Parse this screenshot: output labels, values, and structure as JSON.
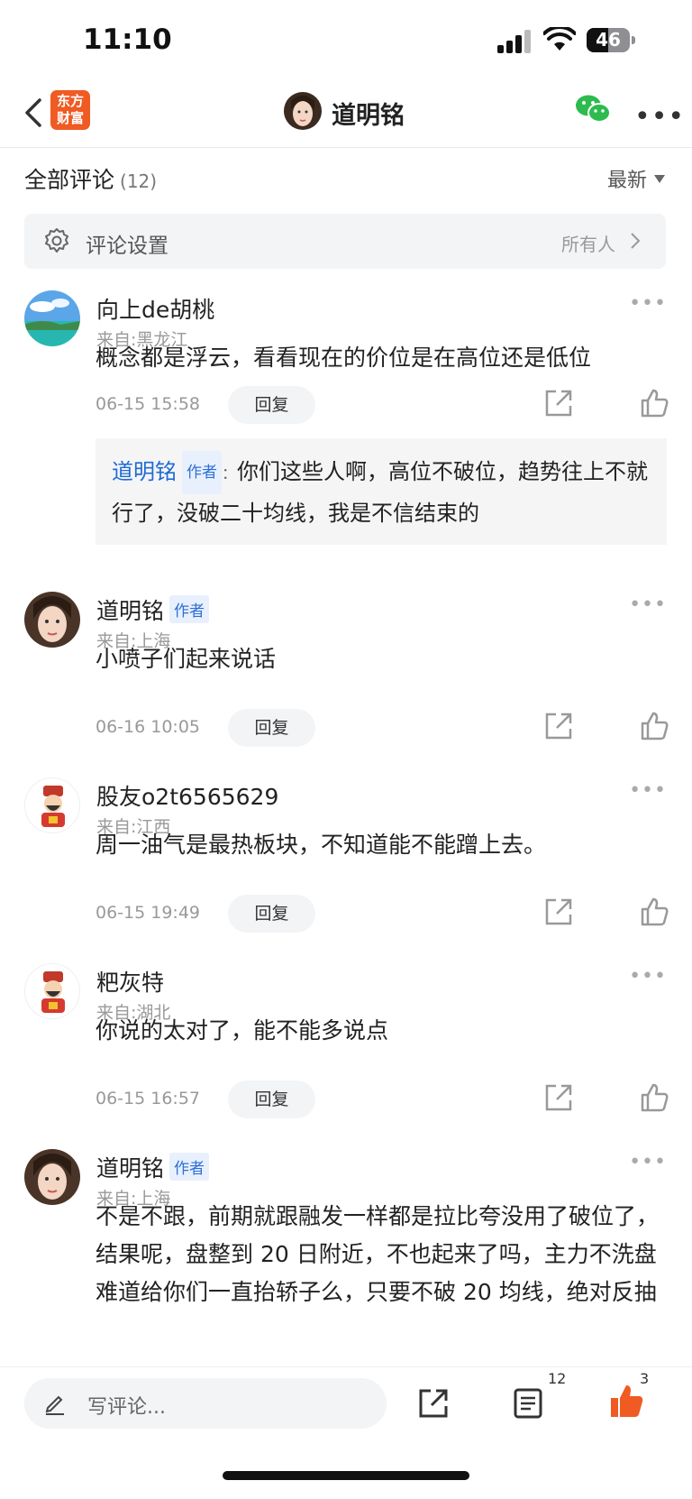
{
  "status": {
    "time": "11:10",
    "battery": "46"
  },
  "nav": {
    "logo_line1": "东方",
    "logo_line2": "财富",
    "title": "道明铭"
  },
  "header": {
    "title": "全部评论",
    "count": "(12)",
    "sort": "最新"
  },
  "settings": {
    "label": "评论设置",
    "value": "所有人"
  },
  "comments": [
    {
      "user": "向上de胡桃",
      "badge": "",
      "location": "来自:黑龙江",
      "text": "概念都是浮云，看看现在的价位是在高位还是低位",
      "date": "06-15 15:58",
      "reply": "回复",
      "sub_reply": {
        "user": "道明铭",
        "badge": "作者",
        "colon": "：",
        "text": "你们这些人啊，高位不破位，趋势往上不就行了，没破二十均线，我是不信结束的"
      }
    },
    {
      "user": "道明铭",
      "badge": "作者",
      "location": "来自:上海",
      "text": "小喷子们起来说话",
      "date": "06-16 10:05",
      "reply": "回复"
    },
    {
      "user": "股友o2t6565629",
      "badge": "",
      "location": "来自:江西",
      "text": "周一油气是最热板块，不知道能不能蹭上去。",
      "date": "06-15 19:49",
      "reply": "回复"
    },
    {
      "user": "粑灰特",
      "badge": "",
      "location": "来自:湖北",
      "text": "你说的太对了，能不能多说点",
      "date": "06-15 16:57",
      "reply": "回复"
    },
    {
      "user": "道明铭",
      "badge": "作者",
      "location": "来自:上海",
      "text": "不是不跟，前期就跟融发一样都是拉比夸没用了破位了，结果呢，盘整到 20 日附近，不也起来了吗，主力不洗盘难道给你们一直抬轿子么，只要不破 20 均线，绝对反抽"
    }
  ],
  "bottom": {
    "placeholder": "写评论...",
    "list_count": "12",
    "like_count": "3"
  },
  "colors": {
    "accent": "#f05a23",
    "link": "#1f6ad6",
    "badge_bg": "#e8f0fd"
  }
}
